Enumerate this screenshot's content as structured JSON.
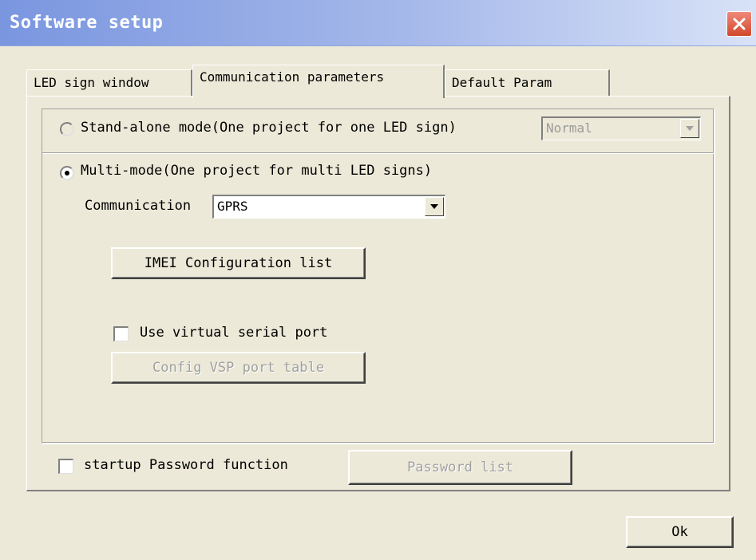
{
  "window": {
    "title": "Software setup"
  },
  "tabs": [
    {
      "label": "LED sign window",
      "active": false
    },
    {
      "label": "Communication parameters",
      "active": true
    },
    {
      "label": "Default Param",
      "active": false
    }
  ],
  "mode": {
    "standalone_label": "Stand-alone mode(One project for one LED sign)",
    "standalone_selected": false,
    "standalone_select_value": "Normal",
    "multi_label": "Multi-mode(One project for multi LED signs)",
    "multi_selected": true
  },
  "communication": {
    "label": "Communication",
    "value": "GPRS"
  },
  "buttons": {
    "imei": "IMEI Configuration list",
    "vsp_config": "Config VSP port table",
    "password_list": "Password list",
    "ok": "Ok"
  },
  "checkboxes": {
    "virtual_serial_port": {
      "label": "Use virtual serial port",
      "checked": false
    },
    "startup_password": {
      "label": "startup Password function",
      "checked": false
    }
  },
  "colors": {
    "dialog_face": "#ece9d8",
    "titlebar_start": "#7a96df",
    "close_button": "#d0482c"
  },
  "icons": [
    "close-icon",
    "chevron-down-icon"
  ]
}
